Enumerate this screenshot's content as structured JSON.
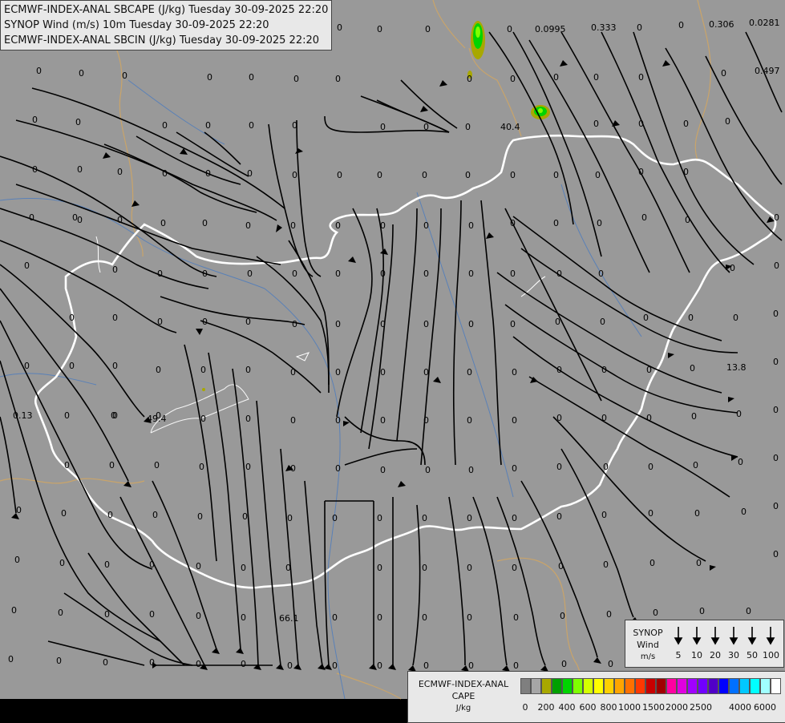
{
  "titles": {
    "line1": "ECMWF-INDEX-ANAL SBCAPE (J/kg) Tuesday 30-09-2025 22:20",
    "line2": "SYNOP Wind (m/s) 10m Tuesday 30-09-2025 22:20",
    "line3": "ECMWF-INDEX-ANAL SBCIN (J/kg) Tuesday 30-09-2025 22:20"
  },
  "colors": {
    "background": "#999999",
    "streamline": "#000000",
    "border": "#ffffff",
    "rivers": "#4a7bbf",
    "regions": "#c9a46a"
  },
  "station_values": [
    "0",
    "0",
    "0",
    "0",
    "0",
    "0",
    "0",
    "0",
    "0",
    "0",
    "0",
    "0",
    "0",
    "0",
    "0",
    "0",
    "0",
    "0",
    "0",
    "0",
    "0.0995",
    "0.333",
    "0.306",
    "0.0281",
    "0.497",
    "40.4",
    "13.8",
    "0.13",
    "49.4",
    "66.1"
  ],
  "special_labels": [
    {
      "text": "0.0995"
    },
    {
      "text": "0.333"
    },
    {
      "text": "0.306"
    },
    {
      "text": "0.0281"
    },
    {
      "text": "0.497"
    },
    {
      "text": "40.4"
    },
    {
      "text": "13.8"
    },
    {
      "text": "0.13"
    },
    {
      "text": "49.4"
    },
    {
      "text": "66.1"
    }
  ],
  "synop_legend": {
    "title_line1": "SYNOP",
    "title_line2": "Wind",
    "title_line3": "m/s",
    "speeds": [
      "5",
      "10",
      "20",
      "30",
      "50",
      "100"
    ]
  },
  "cape_legend": {
    "title_line1": "ECMWF-INDEX-ANAL",
    "title_line2": "CAPE",
    "title_line3": "J/kg",
    "colors": [
      "#7f7f7f",
      "#a6a6a6",
      "#a8a800",
      "#00a000",
      "#00d400",
      "#7fff00",
      "#d4ff00",
      "#ffff00",
      "#ffd000",
      "#ffa500",
      "#ff7000",
      "#ff3800",
      "#c80000",
      "#a00000",
      "#ff00a0",
      "#e000e0",
      "#a000ff",
      "#7000ff",
      "#5000c8",
      "#0000ff",
      "#0070ff",
      "#00c8ff",
      "#00ffff",
      "#a0ffff",
      "#ffffff"
    ],
    "labels": [
      "0",
      "200",
      "400",
      "600",
      "800",
      "1000",
      "1500",
      "2000",
      "2500",
      "4000",
      "6000"
    ]
  }
}
